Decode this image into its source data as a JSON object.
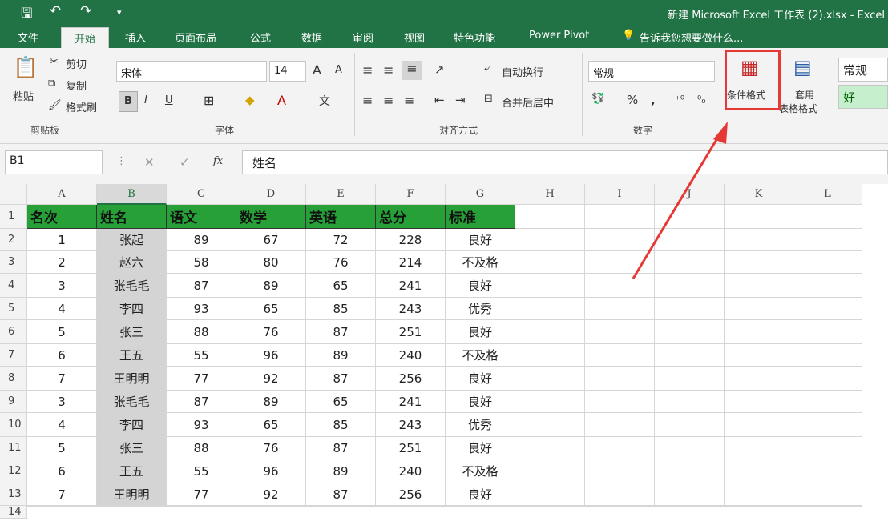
{
  "app": {
    "title": "新建 Microsoft Excel 工作表 (2).xlsx - Excel"
  },
  "tabs": [
    "文件",
    "开始",
    "插入",
    "页面布局",
    "公式",
    "数据",
    "审阅",
    "视图",
    "特色功能",
    "Power Pivot"
  ],
  "tellme": "告诉我您想要做什么...",
  "ribbon": {
    "clipboard": {
      "paste": "粘贴",
      "cut": "剪切",
      "copy": "复制",
      "format_painter": "格式刷",
      "label": "剪贴板"
    },
    "font": {
      "name": "宋体",
      "size": "14",
      "label": "字体",
      "bold": "B",
      "italic": "I",
      "underline": "U",
      "grow": "A",
      "shrink": "A"
    },
    "align": {
      "wrap": "自动换行",
      "merge": "合并后居中",
      "label": "对齐方式"
    },
    "number": {
      "format": "常规",
      "percent": "%",
      "comma": ",",
      "label": "数字"
    },
    "styles": {
      "cond_format": "条件格式",
      "table_format_1": "套用",
      "table_format_2": "表格格式",
      "normal": "常规",
      "good": "好"
    }
  },
  "formula": {
    "namebox": "B1",
    "fx": "fx",
    "value": "姓名"
  },
  "columns": [
    "A",
    "B",
    "C",
    "D",
    "E",
    "F",
    "G",
    "H",
    "I",
    "J",
    "K",
    "L"
  ],
  "rows": [
    "1",
    "2",
    "3",
    "4",
    "5",
    "6",
    "7",
    "8",
    "9",
    "10",
    "11",
    "12",
    "13",
    "14"
  ],
  "table": {
    "headers": [
      "名次",
      "姓名",
      "语文",
      "数学",
      "英语",
      "总分",
      "标准"
    ],
    "data": [
      [
        "1",
        "张起",
        "89",
        "67",
        "72",
        "228",
        "良好"
      ],
      [
        "2",
        "赵六",
        "58",
        "80",
        "76",
        "214",
        "不及格"
      ],
      [
        "3",
        "张毛毛",
        "87",
        "89",
        "65",
        "241",
        "良好"
      ],
      [
        "4",
        "李四",
        "93",
        "65",
        "85",
        "243",
        "优秀"
      ],
      [
        "5",
        "张三",
        "88",
        "76",
        "87",
        "251",
        "良好"
      ],
      [
        "6",
        "王五",
        "55",
        "96",
        "89",
        "240",
        "不及格"
      ],
      [
        "7",
        "王明明",
        "77",
        "92",
        "87",
        "256",
        "良好"
      ],
      [
        "3",
        "张毛毛",
        "87",
        "89",
        "65",
        "241",
        "良好"
      ],
      [
        "4",
        "李四",
        "93",
        "65",
        "85",
        "243",
        "优秀"
      ],
      [
        "5",
        "张三",
        "88",
        "76",
        "87",
        "251",
        "良好"
      ],
      [
        "6",
        "王五",
        "55",
        "96",
        "89",
        "240",
        "不及格"
      ],
      [
        "7",
        "王明明",
        "77",
        "92",
        "87",
        "256",
        "良好"
      ]
    ]
  },
  "colors": {
    "excel_green": "#217346",
    "header_fill": "#27a038",
    "selection": "#d4d4d4",
    "annotation": "#e53935"
  }
}
